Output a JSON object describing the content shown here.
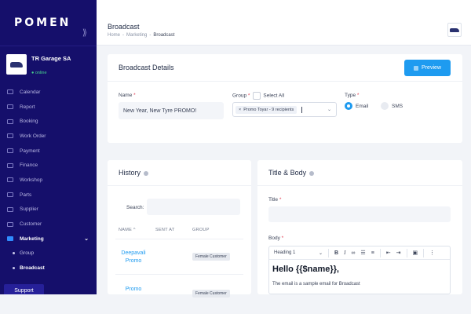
{
  "brand": {
    "logo_text": "POMEN"
  },
  "garage": {
    "name": "TR Garage SA",
    "status": "online"
  },
  "sidebar": {
    "items": [
      {
        "label": "Calendar"
      },
      {
        "label": "Report"
      },
      {
        "label": "Booking"
      },
      {
        "label": "Work Order"
      },
      {
        "label": "Payment"
      },
      {
        "label": "Finance"
      },
      {
        "label": "Workshop"
      },
      {
        "label": "Parts"
      },
      {
        "label": "Supplier"
      },
      {
        "label": "Customer"
      },
      {
        "label": "Marketing"
      }
    ],
    "subitems": [
      {
        "label": "Group"
      },
      {
        "label": "Broadcast"
      }
    ],
    "support_label": "Support"
  },
  "header": {
    "title": "Broadcast",
    "breadcrumb": [
      "Home",
      "-",
      "Marketing",
      "-",
      "Broadcast"
    ]
  },
  "details": {
    "title": "Broadcast Details",
    "preview_label": "Preview",
    "name_label": "Name",
    "name_value": "New Year, New Tyre PROMO!",
    "group_label": "Group",
    "select_all_label": "Select All",
    "group_chip": "Promo Toyar - 9 recipients",
    "type_label": "Type",
    "type_options": [
      "Email",
      "SMS"
    ],
    "type_selected": "Email"
  },
  "history": {
    "title": "History",
    "search_label": "Search:",
    "columns": [
      "NAME",
      "SENT AT",
      "GROUP"
    ],
    "sort_indicator": "^",
    "rows": [
      {
        "name": "Deepavali Promo",
        "group": "Female Customer"
      },
      {
        "name": "Promo",
        "group": "Female Customer"
      }
    ]
  },
  "title_body": {
    "title": "Title & Body",
    "title_label": "Title",
    "body_label": "Body",
    "toolbar": {
      "format": "Heading 1",
      "bold": "B",
      "italic": "I",
      "more": "⋮"
    },
    "heading": "Hello {{$name}},",
    "paragraph": "The email is a sample email for Broadcast"
  },
  "colors": {
    "sidebar_bg": "#150f6b",
    "accent": "#1e9bf0",
    "required": "#e0394e"
  }
}
